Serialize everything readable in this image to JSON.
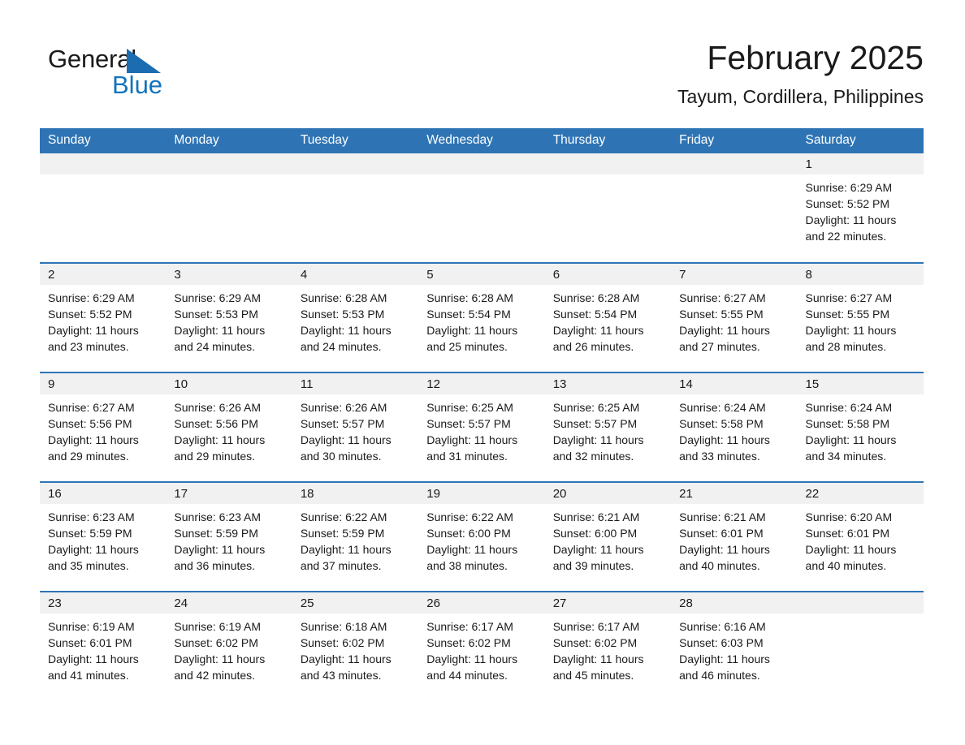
{
  "brand": {
    "name_part1": "General",
    "name_part2": "Blue",
    "accent_color": "#1473bb",
    "triangle_color": "#1b6cb0"
  },
  "header": {
    "title": "February 2025",
    "location": "Tayum, Cordillera, Philippines"
  },
  "calendar": {
    "header_bg": "#2e74b5",
    "daynum_bg": "#f1f1f1",
    "weekday_headers": [
      "Sunday",
      "Monday",
      "Tuesday",
      "Wednesday",
      "Thursday",
      "Friday",
      "Saturday"
    ],
    "weeks": [
      [
        {
          "day": "",
          "empty": true
        },
        {
          "day": "",
          "empty": true
        },
        {
          "day": "",
          "empty": true
        },
        {
          "day": "",
          "empty": true
        },
        {
          "day": "",
          "empty": true
        },
        {
          "day": "",
          "empty": true
        },
        {
          "day": "1",
          "sunrise": "Sunrise: 6:29 AM",
          "sunset": "Sunset: 5:52 PM",
          "daylight": "Daylight: 11 hours and 22 minutes."
        }
      ],
      [
        {
          "day": "2",
          "sunrise": "Sunrise: 6:29 AM",
          "sunset": "Sunset: 5:52 PM",
          "daylight": "Daylight: 11 hours and 23 minutes."
        },
        {
          "day": "3",
          "sunrise": "Sunrise: 6:29 AM",
          "sunset": "Sunset: 5:53 PM",
          "daylight": "Daylight: 11 hours and 24 minutes."
        },
        {
          "day": "4",
          "sunrise": "Sunrise: 6:28 AM",
          "sunset": "Sunset: 5:53 PM",
          "daylight": "Daylight: 11 hours and 24 minutes."
        },
        {
          "day": "5",
          "sunrise": "Sunrise: 6:28 AM",
          "sunset": "Sunset: 5:54 PM",
          "daylight": "Daylight: 11 hours and 25 minutes."
        },
        {
          "day": "6",
          "sunrise": "Sunrise: 6:28 AM",
          "sunset": "Sunset: 5:54 PM",
          "daylight": "Daylight: 11 hours and 26 minutes."
        },
        {
          "day": "7",
          "sunrise": "Sunrise: 6:27 AM",
          "sunset": "Sunset: 5:55 PM",
          "daylight": "Daylight: 11 hours and 27 minutes."
        },
        {
          "day": "8",
          "sunrise": "Sunrise: 6:27 AM",
          "sunset": "Sunset: 5:55 PM",
          "daylight": "Daylight: 11 hours and 28 minutes."
        }
      ],
      [
        {
          "day": "9",
          "sunrise": "Sunrise: 6:27 AM",
          "sunset": "Sunset: 5:56 PM",
          "daylight": "Daylight: 11 hours and 29 minutes."
        },
        {
          "day": "10",
          "sunrise": "Sunrise: 6:26 AM",
          "sunset": "Sunset: 5:56 PM",
          "daylight": "Daylight: 11 hours and 29 minutes."
        },
        {
          "day": "11",
          "sunrise": "Sunrise: 6:26 AM",
          "sunset": "Sunset: 5:57 PM",
          "daylight": "Daylight: 11 hours and 30 minutes."
        },
        {
          "day": "12",
          "sunrise": "Sunrise: 6:25 AM",
          "sunset": "Sunset: 5:57 PM",
          "daylight": "Daylight: 11 hours and 31 minutes."
        },
        {
          "day": "13",
          "sunrise": "Sunrise: 6:25 AM",
          "sunset": "Sunset: 5:57 PM",
          "daylight": "Daylight: 11 hours and 32 minutes."
        },
        {
          "day": "14",
          "sunrise": "Sunrise: 6:24 AM",
          "sunset": "Sunset: 5:58 PM",
          "daylight": "Daylight: 11 hours and 33 minutes."
        },
        {
          "day": "15",
          "sunrise": "Sunrise: 6:24 AM",
          "sunset": "Sunset: 5:58 PM",
          "daylight": "Daylight: 11 hours and 34 minutes."
        }
      ],
      [
        {
          "day": "16",
          "sunrise": "Sunrise: 6:23 AM",
          "sunset": "Sunset: 5:59 PM",
          "daylight": "Daylight: 11 hours and 35 minutes."
        },
        {
          "day": "17",
          "sunrise": "Sunrise: 6:23 AM",
          "sunset": "Sunset: 5:59 PM",
          "daylight": "Daylight: 11 hours and 36 minutes."
        },
        {
          "day": "18",
          "sunrise": "Sunrise: 6:22 AM",
          "sunset": "Sunset: 5:59 PM",
          "daylight": "Daylight: 11 hours and 37 minutes."
        },
        {
          "day": "19",
          "sunrise": "Sunrise: 6:22 AM",
          "sunset": "Sunset: 6:00 PM",
          "daylight": "Daylight: 11 hours and 38 minutes."
        },
        {
          "day": "20",
          "sunrise": "Sunrise: 6:21 AM",
          "sunset": "Sunset: 6:00 PM",
          "daylight": "Daylight: 11 hours and 39 minutes."
        },
        {
          "day": "21",
          "sunrise": "Sunrise: 6:21 AM",
          "sunset": "Sunset: 6:01 PM",
          "daylight": "Daylight: 11 hours and 40 minutes."
        },
        {
          "day": "22",
          "sunrise": "Sunrise: 6:20 AM",
          "sunset": "Sunset: 6:01 PM",
          "daylight": "Daylight: 11 hours and 40 minutes."
        }
      ],
      [
        {
          "day": "23",
          "sunrise": "Sunrise: 6:19 AM",
          "sunset": "Sunset: 6:01 PM",
          "daylight": "Daylight: 11 hours and 41 minutes."
        },
        {
          "day": "24",
          "sunrise": "Sunrise: 6:19 AM",
          "sunset": "Sunset: 6:02 PM",
          "daylight": "Daylight: 11 hours and 42 minutes."
        },
        {
          "day": "25",
          "sunrise": "Sunrise: 6:18 AM",
          "sunset": "Sunset: 6:02 PM",
          "daylight": "Daylight: 11 hours and 43 minutes."
        },
        {
          "day": "26",
          "sunrise": "Sunrise: 6:17 AM",
          "sunset": "Sunset: 6:02 PM",
          "daylight": "Daylight: 11 hours and 44 minutes."
        },
        {
          "day": "27",
          "sunrise": "Sunrise: 6:17 AM",
          "sunset": "Sunset: 6:02 PM",
          "daylight": "Daylight: 11 hours and 45 minutes."
        },
        {
          "day": "28",
          "sunrise": "Sunrise: 6:16 AM",
          "sunset": "Sunset: 6:03 PM",
          "daylight": "Daylight: 11 hours and 46 minutes."
        },
        {
          "day": "",
          "empty": true
        }
      ]
    ]
  }
}
